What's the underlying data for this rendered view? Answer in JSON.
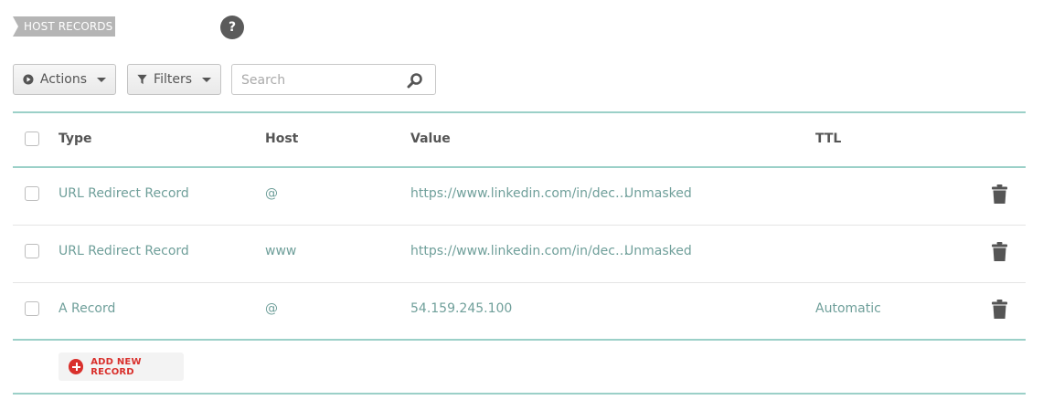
{
  "section": {
    "title": "HOST RECORDS",
    "help_label": "?"
  },
  "toolbar": {
    "actions_label": "Actions",
    "filters_label": "Filters",
    "search_placeholder": "Search"
  },
  "table": {
    "columns": {
      "type": "Type",
      "host": "Host",
      "value": "Value",
      "ttl": "TTL"
    },
    "rows": [
      {
        "type": "URL Redirect Record",
        "host": "@",
        "value": "https://www.linkedin.com/in/dec…",
        "mode": "Unmasked",
        "ttl": ""
      },
      {
        "type": "URL Redirect Record",
        "host": "www",
        "value": "https://www.linkedin.com/in/dec…",
        "mode": "Unmasked",
        "ttl": ""
      },
      {
        "type": "A Record",
        "host": "@",
        "value": "54.159.245.100",
        "mode": "",
        "ttl": "Automatic"
      }
    ]
  },
  "footer": {
    "add_label": "ADD NEW RECORD"
  },
  "colors": {
    "accent_rule": "#9bd0c8",
    "link_text": "#6f9f9a",
    "add_red": "#d9302c"
  }
}
